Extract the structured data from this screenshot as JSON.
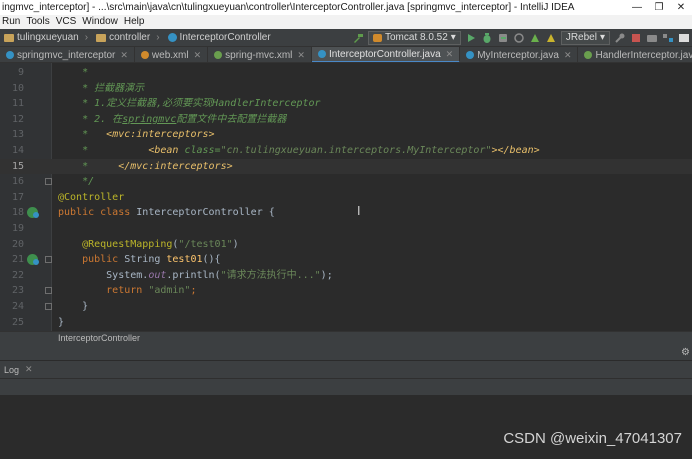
{
  "window": {
    "title": "ingmvc_interceptor] - ...\\src\\main\\java\\cn\\tulingxueyuan\\controller\\InterceptorController.java [springmvc_interceptor] - IntelliJ IDEA",
    "controls": [
      "—",
      "❐",
      "✕"
    ]
  },
  "menu": [
    "Run",
    "Tools",
    "VCS",
    "Window",
    "Help"
  ],
  "nav": {
    "crumbs": [
      "tulingxueyuan",
      "controller",
      "InterceptorController"
    ],
    "run_config": "Tomcat 8.0.52",
    "jrebel": "JRebel"
  },
  "tabs": [
    {
      "label": "springmvc_interceptor",
      "icon_color": "#3592c4",
      "icon": "module-icon",
      "active": false
    },
    {
      "label": "web.xml",
      "icon_color": "#d08a2c",
      "icon": "xml-file-icon",
      "active": false
    },
    {
      "label": "spring-mvc.xml",
      "icon_color": "#6a9f4e",
      "icon": "spring-xml-icon",
      "active": false
    },
    {
      "label": "InterceptorController.java",
      "icon_color": "#3592c4",
      "icon": "java-class-icon",
      "active": true
    },
    {
      "label": "MyInterceptor.java",
      "icon_color": "#3592c4",
      "icon": "java-class-icon",
      "active": false
    },
    {
      "label": "HandlerInterceptor.java",
      "icon_color": "#6a9f4e",
      "icon": "java-interface-icon",
      "active": false
    }
  ],
  "editor": {
    "lines": [
      {
        "n": "9",
        "spans": [
          {
            "c": "c-com",
            "t": "    *"
          }
        ]
      },
      {
        "n": "10",
        "spans": [
          {
            "c": "c-com",
            "t": "    * 拦截器演示"
          }
        ]
      },
      {
        "n": "11",
        "spans": [
          {
            "c": "c-com",
            "t": "    * 1.定义拦截器,必须要实现HandlerInterceptor"
          }
        ]
      },
      {
        "n": "12",
        "spans": [
          {
            "c": "c-com",
            "t": "    * 2. 在"
          },
          {
            "c": "c-com c-under",
            "t": "springmvc"
          },
          {
            "c": "c-com",
            "t": "配置文件中去配置拦截器"
          }
        ]
      },
      {
        "n": "13",
        "spans": [
          {
            "c": "c-com",
            "t": "    *   "
          },
          {
            "c": "c-tag",
            "t": "<mvc:interceptors>"
          }
        ]
      },
      {
        "n": "14",
        "spans": [
          {
            "c": "c-com",
            "t": "    *          "
          },
          {
            "c": "c-tag",
            "t": "<bean "
          },
          {
            "c": "c-com",
            "t": "class="
          },
          {
            "c": "c-attr",
            "t": "\"cn.tulingxueyuan.interceptors.MyInterceptor\""
          },
          {
            "c": "c-tag",
            "t": "></bean>"
          }
        ]
      },
      {
        "n": "15",
        "spans": [
          {
            "c": "c-com",
            "t": "    *     "
          },
          {
            "c": "c-tag",
            "t": "</mvc:interceptors>"
          }
        ],
        "current": true
      },
      {
        "n": "16",
        "spans": [
          {
            "c": "c-com",
            "t": "    */"
          }
        ]
      },
      {
        "n": "17",
        "spans": [
          {
            "c": "c-anno",
            "t": "@Controller"
          }
        ]
      },
      {
        "n": "18",
        "spans": [
          {
            "c": "c-kw",
            "t": "public class "
          },
          {
            "c": "c-plain",
            "t": "InterceptorController {"
          }
        ]
      },
      {
        "n": "19",
        "spans": []
      },
      {
        "n": "20",
        "spans": [
          {
            "c": "c-anno",
            "t": "    @RequestMapping"
          },
          {
            "c": "c-plain",
            "t": "("
          },
          {
            "c": "c-str",
            "t": "\"/test01\""
          },
          {
            "c": "c-plain",
            "t": ")"
          }
        ]
      },
      {
        "n": "21",
        "spans": [
          {
            "c": "c-kw",
            "t": "    public "
          },
          {
            "c": "c-plain",
            "t": "String "
          },
          {
            "c": "c-fn",
            "t": "test01"
          },
          {
            "c": "c-plain",
            "t": "(){"
          }
        ]
      },
      {
        "n": "22",
        "spans": [
          {
            "c": "c-plain",
            "t": "        System."
          },
          {
            "c": "c-field",
            "t": "out"
          },
          {
            "c": "c-plain",
            "t": ".println("
          },
          {
            "c": "c-str",
            "t": "\"请求方法执行中...\""
          },
          {
            "c": "c-plain",
            "t": ");"
          }
        ]
      },
      {
        "n": "23",
        "spans": [
          {
            "c": "c-kw",
            "t": "        return "
          },
          {
            "c": "c-str",
            "t": "\"admin\""
          },
          {
            "c": "c-kw",
            "t": ";"
          }
        ]
      },
      {
        "n": "24",
        "spans": [
          {
            "c": "c-plain",
            "t": "    }"
          }
        ]
      },
      {
        "n": "25",
        "spans": [
          {
            "c": "c-plain",
            "t": "}"
          }
        ]
      }
    ]
  },
  "editor_breadcrumb": "InterceptorController",
  "bottom_tab": "Log",
  "watermark": "CSDN @weixin_47041307"
}
